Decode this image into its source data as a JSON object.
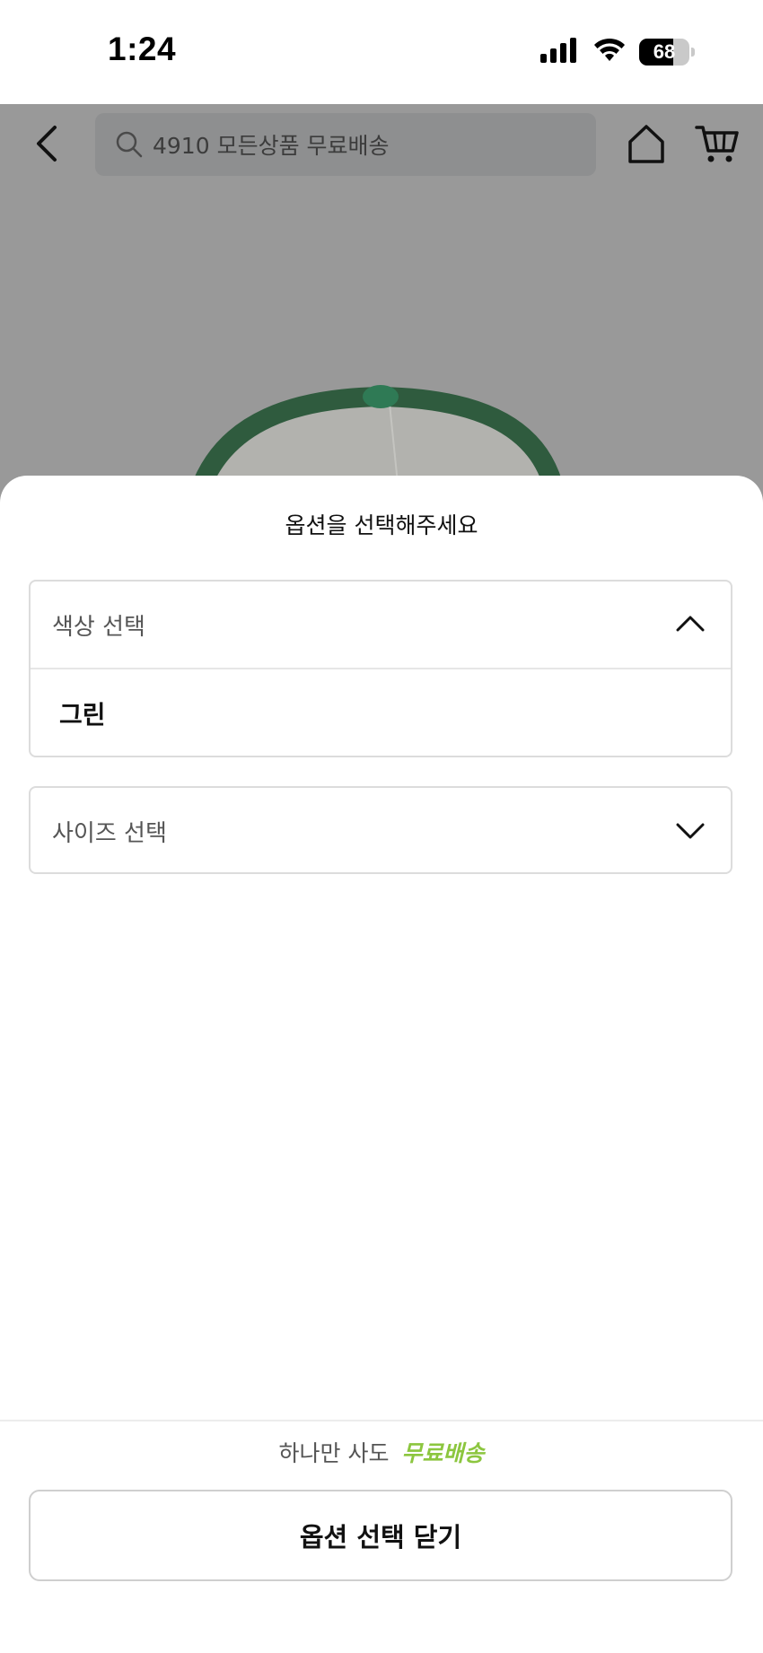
{
  "status_bar": {
    "time": "1:24",
    "battery_level": "68",
    "icons": [
      "cellular-signal-icon",
      "wifi-icon",
      "battery-icon"
    ]
  },
  "header": {
    "search_text": "4910 모든상품 무료배송",
    "icons": [
      "back-arrow-icon",
      "search-icon",
      "home-icon",
      "cart-icon"
    ]
  },
  "sheet": {
    "title": "옵션을 선택해주세요",
    "color_select": {
      "label": "색상 선택",
      "expanded": true,
      "options": [
        "그린"
      ]
    },
    "size_select": {
      "label": "사이즈 선택",
      "expanded": false
    },
    "banner": {
      "prefix": "하나만 사도",
      "highlight": "무료배송"
    },
    "close_button": "옵션 선택 닫기"
  },
  "colors": {
    "overlay": "#999999",
    "free_shipping_accent": "#8cc63f",
    "product_green": "#2f6b45"
  }
}
